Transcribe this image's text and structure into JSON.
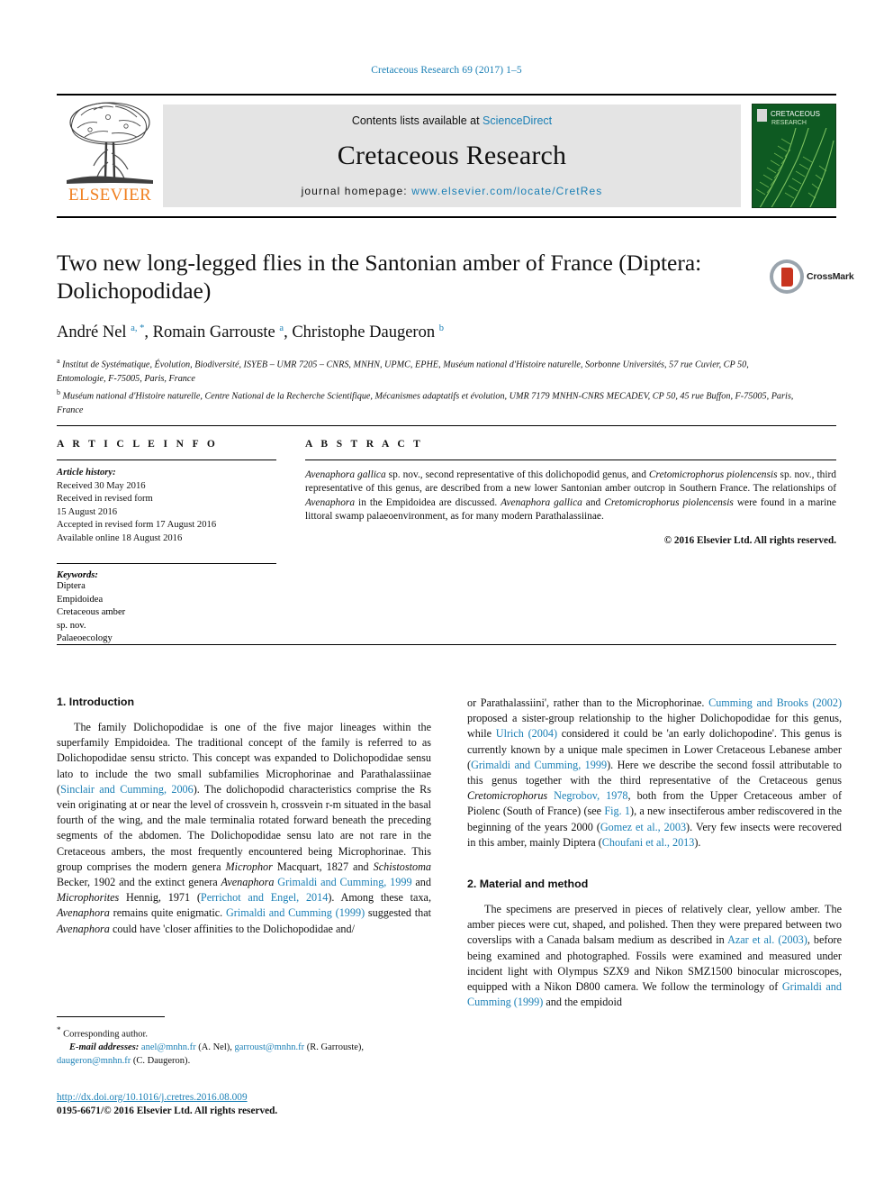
{
  "running_head": "Cretaceous Research 69 (2017) 1–5",
  "masthead": {
    "contents_prefix": "Contents lists available at ",
    "sciencedirect": "ScienceDirect",
    "journal_title": "Cretaceous Research",
    "homepage_prefix": "journal homepage: ",
    "homepage_url": "www.elsevier.com/locate/CretRes",
    "publisher": "ELSEVIER",
    "cover_title_line1": "CRETACEOUS",
    "cover_title_line2": "RESEARCH"
  },
  "crossmark": {
    "label": "CrossMark"
  },
  "article": {
    "title": "Two new long-legged flies in the Santonian amber of France (Diptera: Dolichopodidae)",
    "authors_html": "André Nel <sup>a, *</sup>, Romain Garrouste <sup>a</sup>, Christophe Daugeron <sup>b</sup>",
    "affiliation_a": "Institut de Systématique, Évolution, Biodiversité, ISYEB – UMR 7205 – CNRS, MNHN, UPMC, EPHE, Muséum national d'Histoire naturelle, Sorbonne Universités, 57 rue Cuvier, CP 50, Entomologie, F-75005, Paris, France",
    "affiliation_b": "Muséum national d'Histoire naturelle, Centre National de la Recherche Scientifique, Mécanismes adaptatifs et évolution, UMR 7179 MNHN-CNRS MECADEV, CP 50, 45 rue Buffon, F-75005, Paris, France"
  },
  "article_info": {
    "heading": "A R T I C L E   I N F O",
    "history_label": "Article history:",
    "history": [
      "Received 30 May 2016",
      "Received in revised form",
      "15 August 2016",
      "Accepted in revised form 17 August 2016",
      "Available online 18 August 2016"
    ],
    "keywords_label": "Keywords:",
    "keywords": [
      "Diptera",
      "Empidoidea",
      "Cretaceous amber",
      "sp. nov.",
      "Palaeoecology"
    ]
  },
  "abstract": {
    "heading": "A B S T R A C T",
    "text_html": "<i>Avenaphora gallica</i> sp. nov., second representative of this dolichopodid genus, and <i>Cretomicrophorus piolencensis</i> sp. nov., third representative of this genus, are described from a new lower Santonian amber outcrop in Southern France. The relationships of <i>Avenaphora</i> in the Empidoidea are discussed. <i>Avenaphora gallica</i> and <i>Cretomicrophorus piolencensis</i> were found in a marine littoral swamp palaeoenvironment, as for many modern Parathalassiinae.",
    "copyright": "© 2016 Elsevier Ltd. All rights reserved."
  },
  "sections": {
    "introduction_title": "1.  Introduction",
    "introduction_p1_html": "The family Dolichopodidae is one of the five major lineages within the superfamily Empidoidea. The traditional concept of the family is referred to as Dolichopodidae sensu stricto. This concept was expanded to Dolichopodidae sensu lato to include the two small subfamilies Microphorinae and Parathalassiinae (<a class=\"ref\" href=\"#\">Sinclair and Cumming, 2006</a>). The dolichopodid characteristics comprise the Rs vein originating at or near the level of crossvein h, crossvein r-m situated in the basal fourth of the wing, and the male terminalia rotated forward beneath the preceding segments of the abdomen. The Dolichopodidae sensu lato are not rare in the Cretaceous ambers, the most frequently encountered being Microphorinae. This group comprises the modern genera <i>Microphor</i> Macquart, 1827 and <i>Schistostoma</i> Becker, 1902 and the extinct genera <i>Avenaphora</i> <a class=\"ref\" href=\"#\">Grimaldi and Cumming, 1999</a> and <i>Microphorites</i> Hennig, 1971 (<a class=\"ref\" href=\"#\">Perrichot and Engel, 2014</a>). Among these taxa, <i>Avenaphora</i> remains quite enigmatic. <a class=\"ref\" href=\"#\">Grimaldi and Cumming (1999)</a> suggested that <i>Avenaphora</i> could have 'closer affinities to the Dolichopodidae and/",
    "introduction_p1_cont_html": "or Parathalassiini', rather than to the Microphorinae. <a class=\"ref\" href=\"#\">Cumming and Brooks (2002)</a> proposed a sister-group relationship to the higher Dolichopodidae for this genus, while <a class=\"ref\" href=\"#\">Ulrich (2004)</a> considered it could be 'an early dolichopodine'. This genus is currently known by a unique male specimen in Lower Cretaceous Lebanese amber (<a class=\"ref\" href=\"#\">Grimaldi and Cumming, 1999</a>). Here we describe the second fossil attributable to this genus together with the third representative of the Cretaceous genus <i>Cretomicrophorus</i> <a class=\"ref\" href=\"#\">Negrobov, 1978</a>, both from the Upper Cretaceous amber of Piolenc (South of France) (see <a class=\"ref\" href=\"#\">Fig. 1</a>), a new insectiferous amber rediscovered in the beginning of the years 2000 (<a class=\"ref\" href=\"#\">Gomez et al., 2003</a>). Very few insects were recovered in this amber, mainly Diptera (<a class=\"ref\" href=\"#\">Choufani et al., 2013</a>).",
    "material_title": "2.  Material and method",
    "material_p1_html": "The specimens are preserved in pieces of relatively clear, yellow amber. The amber pieces were cut, shaped, and polished. Then they were prepared between two coverslips with a Canada balsam medium as described in <a class=\"ref\" href=\"#\">Azar et al. (2003)</a>, before being examined and photographed. Fossils were examined and measured under incident light with Olympus SZX9 and Nikon SMZ1500 binocular microscopes, equipped with a Nikon D800 camera. We follow the terminology of <a class=\"ref\" href=\"#\">Grimaldi and Cumming (1999)</a> and the empidoid"
  },
  "footnotes": {
    "corresponding": "Corresponding author.",
    "email_label": "E-mail addresses:",
    "email1": "anel@mnhn.fr",
    "email1_name": "(A. Nel)",
    "email2": "garroust@mnhn.fr",
    "email2_name": "(R. Garrouste)",
    "email3": "daugeron@mnhn.fr",
    "email3_name": "(C. Daugeron)"
  },
  "footer": {
    "doi": "http://dx.doi.org/10.1016/j.cretres.2016.08.009",
    "issn": "0195-6671/© 2016 Elsevier Ltd. All rights reserved."
  },
  "colors": {
    "link": "#1a7fb5",
    "elsevier_orange": "#f08021",
    "crossmark_red": "#c8341f"
  }
}
